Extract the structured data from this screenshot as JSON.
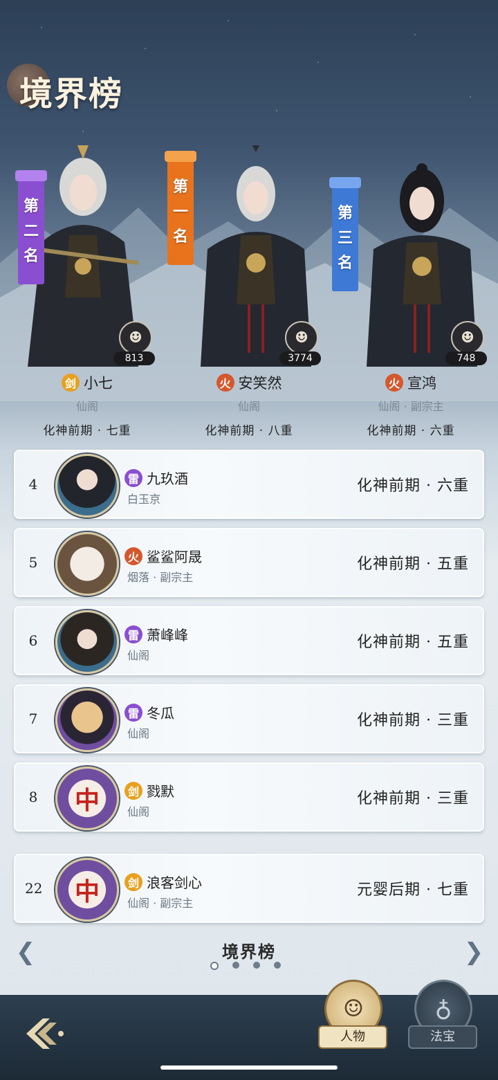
{
  "page_title": "境界榜",
  "top_three": [
    {
      "banner": [
        "第",
        "二",
        "名"
      ],
      "name": "小七",
      "element": "剑",
      "sect": "仙阁",
      "realm": "化神前期 · 七重",
      "likes": "813"
    },
    {
      "banner": [
        "第",
        "一",
        "名"
      ],
      "name": "安笑然",
      "element": "火",
      "sect": "仙阁",
      "realm": "化神前期 · 八重",
      "likes": "3774"
    },
    {
      "banner": [
        "第",
        "三",
        "名"
      ],
      "name": "宣鸿",
      "element": "火",
      "sect": "仙阁 · 副宗主",
      "realm": "化神前期 · 六重",
      "likes": "748"
    }
  ],
  "rows": [
    {
      "rank": "4",
      "element": "雷",
      "name": "九玖酒",
      "sect": "白玉京",
      "realm": "化神前期 · 六重"
    },
    {
      "rank": "5",
      "element": "火",
      "name": "鲨鲨阿晟",
      "sect": "烟落 · 副宗主",
      "realm": "化神前期 · 五重"
    },
    {
      "rank": "6",
      "element": "雷",
      "name": "萧峰峰",
      "sect": "仙阁",
      "realm": "化神前期 · 五重"
    },
    {
      "rank": "7",
      "element": "雷",
      "name": "冬瓜",
      "sect": "仙阁",
      "realm": "化神前期 · 三重"
    },
    {
      "rank": "8",
      "element": "剑",
      "name": "戮默",
      "sect": "仙阁",
      "realm": "化神前期 · 三重"
    }
  ],
  "self_row": {
    "rank": "22",
    "element": "剑",
    "name": "浪客剑心",
    "sect": "仙阁 · 副宗主",
    "realm": "元婴后期 · 七重"
  },
  "avatar_glyphs": {
    "mahjong": "中"
  },
  "nav": {
    "title": "境界榜",
    "pages": 4,
    "active_page": 1
  },
  "tabs": {
    "characters": "人物",
    "treasures": "法宝"
  },
  "colors": {
    "sword": "#e8a01e",
    "fire": "#d5582d",
    "thunder": "#8a4fd0",
    "first": "#e8731c",
    "second": "#8a4fd0",
    "third": "#3e79d6"
  },
  "icons": {
    "back": "back-arrow-icon",
    "like": "like-icon",
    "prev": "chevron-left-icon",
    "next": "chevron-right-icon"
  }
}
